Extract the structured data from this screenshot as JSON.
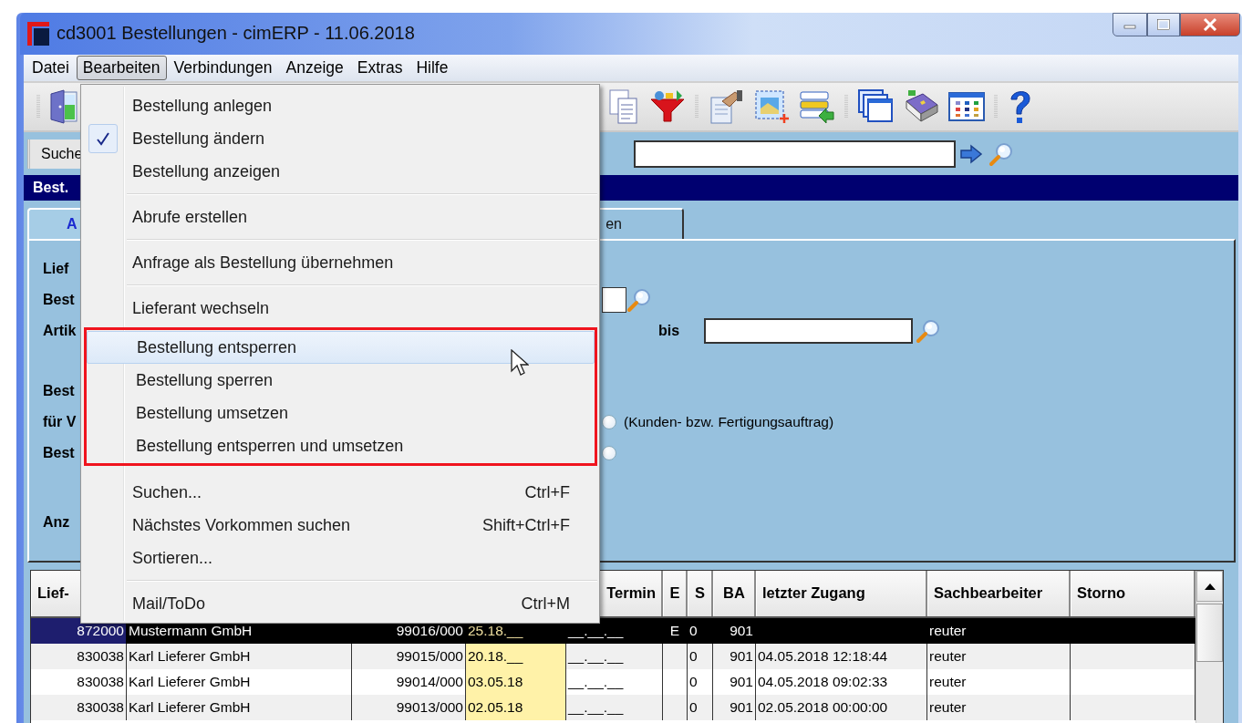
{
  "window": {
    "title": "cd3001 Bestellungen - cimERP - 11.06.2018"
  },
  "menubar": [
    {
      "label": "Datei",
      "selected": false
    },
    {
      "label": "Bearbeiten",
      "selected": true
    },
    {
      "label": "Verbindungen",
      "selected": false
    },
    {
      "label": "Anzeige",
      "selected": false
    },
    {
      "label": "Extras",
      "selected": false
    },
    {
      "label": "Hilfe",
      "selected": false
    }
  ],
  "search": {
    "label": "Suche"
  },
  "section_bar": {
    "title": "Best."
  },
  "tabs": [
    {
      "label": "A",
      "selected": true
    },
    {
      "label": "en",
      "selected": false
    }
  ],
  "form": {
    "rows": [
      {
        "kind": "text",
        "label": "Lief"
      },
      {
        "kind": "lookup",
        "label": "Best"
      },
      {
        "kind": "range",
        "label": "Artik",
        "range_label": "bis"
      },
      {
        "kind": "text",
        "label": "Best"
      },
      {
        "kind": "radio",
        "label": "für V",
        "selected": false,
        "note": "(Kunden- bzw. Fertigungsauftrag)"
      },
      {
        "kind": "radio",
        "label": "Best",
        "selected": false
      },
      {
        "kind": "text",
        "label": "Anz"
      }
    ]
  },
  "table": {
    "header_left": "Lief-",
    "header_right": [
      "Termin",
      "E",
      "S",
      "BA",
      "letzter Zugang",
      "Sachbearbeiter",
      "Storno"
    ],
    "rows": [
      {
        "selected": true,
        "lief_nr": "872000",
        "name": "Mustermann GmbH",
        "order_no": "99016/000",
        "date": "25.18.__",
        "termin": "__.__.__",
        "e": "E",
        "s": "0",
        "ba": "901",
        "sachbearbeiter": "reuter"
      },
      {
        "selected": false,
        "lief_nr": "830038",
        "name": "Karl Lieferer GmbH",
        "order_no": "99015/000",
        "date": "20.18.__",
        "termin": "__.__.__",
        "s": "0",
        "ba": "901",
        "letzter_zugang": "04.05.2018 12:18:44",
        "sachbearbeiter": "reuter"
      },
      {
        "selected": false,
        "lief_nr": "830038",
        "name": "Karl Lieferer GmbH",
        "order_no": "99014/000",
        "date": "03.05.18",
        "termin": "__.__.__",
        "s": "0",
        "ba": "901",
        "letzter_zugang": "04.05.2018 09:02:33",
        "sachbearbeiter": "reuter"
      },
      {
        "selected": false,
        "lief_nr": "830038",
        "name": "Karl Lieferer GmbH",
        "order_no": "99013/000",
        "date": "02.05.18",
        "termin": "__.__.__",
        "s": "0",
        "ba": "901",
        "letzter_zugang": "02.05.2018 00:00:00",
        "sachbearbeiter": "reuter"
      }
    ]
  },
  "menu": {
    "groups": [
      {
        "framed": false,
        "items": [
          {
            "label": "Bestellung anlegen",
            "checked": false,
            "highlighted": false
          },
          {
            "label": "Bestellung ändern",
            "checked": true,
            "highlighted": false
          },
          {
            "label": "Bestellung anzeigen",
            "checked": false,
            "highlighted": false
          }
        ]
      },
      {
        "framed": false,
        "items": [
          {
            "label": "Abrufe erstellen",
            "checked": false,
            "highlighted": false
          }
        ]
      },
      {
        "framed": false,
        "items": [
          {
            "label": "Anfrage als Bestellung übernehmen",
            "checked": false,
            "highlighted": false
          }
        ]
      },
      {
        "framed": false,
        "items": [
          {
            "label": "Lieferant wechseln",
            "checked": false,
            "highlighted": false
          }
        ]
      },
      {
        "framed": true,
        "items": [
          {
            "label": "Bestellung entsperren",
            "checked": false,
            "highlighted": true
          },
          {
            "label": "Bestellung sperren",
            "checked": false,
            "highlighted": false
          },
          {
            "label": "Bestellung umsetzen",
            "checked": false,
            "highlighted": false
          },
          {
            "label": "Bestellung entsperren und umsetzen",
            "checked": false,
            "highlighted": false
          }
        ]
      },
      {
        "framed": false,
        "items": [
          {
            "label": "Suchen...",
            "shortcut": "Ctrl+F",
            "checked": false,
            "highlighted": false
          },
          {
            "label": "Nächstes Vorkommen suchen",
            "shortcut": "Shift+Ctrl+F",
            "checked": false,
            "highlighted": false
          },
          {
            "label": "Sortieren...",
            "checked": false,
            "highlighted": false
          }
        ]
      },
      {
        "framed": false,
        "items": [
          {
            "label": "Mail/ToDo",
            "shortcut": "Ctrl+M",
            "checked": false,
            "highlighted": false
          }
        ]
      }
    ]
  }
}
